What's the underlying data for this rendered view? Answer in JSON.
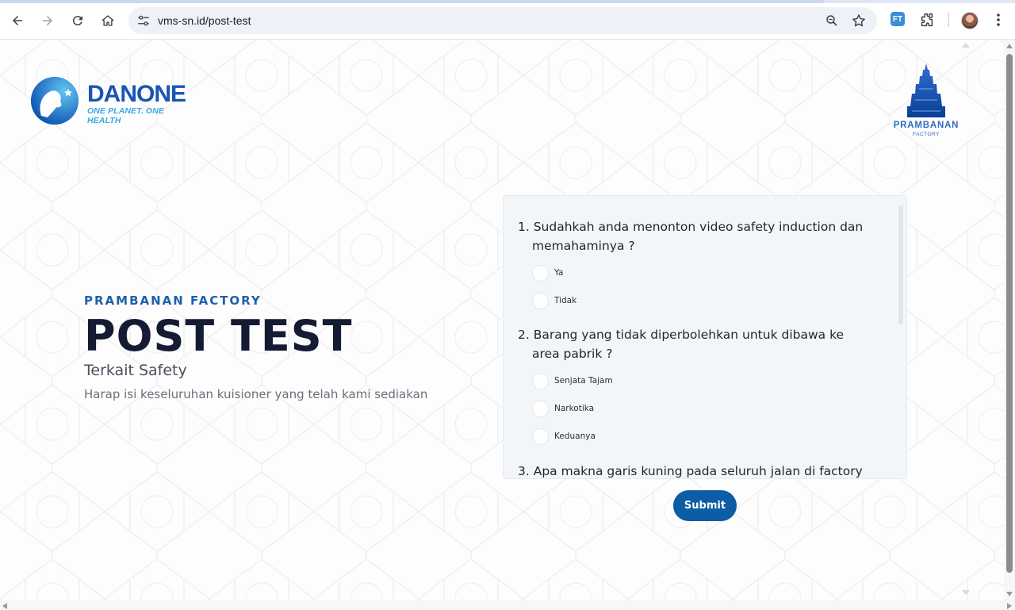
{
  "browser": {
    "url": "vms-sn.id/post-test",
    "extension_label": "FT",
    "icons": [
      "back-icon",
      "forward-icon",
      "reload-icon",
      "home-icon",
      "site-settings-icon",
      "zoom-icon",
      "bookmark-star-icon",
      "extensions-puzzle-icon",
      "profile-avatar",
      "more-menu-icon"
    ]
  },
  "logos": {
    "danone_wordmark": "DANONE",
    "danone_tagline": "ONE PLANET. ONE HEALTH",
    "prambanan_name": "PRAMBANAN",
    "prambanan_sub": "FACTORY"
  },
  "hero": {
    "eyebrow": "PRAMBANAN FACTORY",
    "title": "POST TEST",
    "subtitle": "Terkait Safety",
    "description": "Harap isi keseluruhan kuisioner yang telah kami sediakan"
  },
  "quiz": {
    "questions": [
      {
        "text": "1. Sudahkah anda menonton video safety induction dan memahaminya ?",
        "options": [
          "Ya",
          "Tidak"
        ]
      },
      {
        "text": "2. Barang yang tidak diperbolehkan untuk dibawa ke area pabrik ?",
        "options": [
          "Senjata Tajam",
          "Narkotika",
          "Keduanya"
        ]
      },
      {
        "text": "3. Apa makna garis kuning pada seluruh jalan di factory ?",
        "options": []
      }
    ],
    "submit_label": "Submit"
  },
  "colors": {
    "primary": "#0c5ca6",
    "eyebrow": "#1d61a8",
    "title": "#141b33",
    "panel_bg": "#f3f6f9"
  }
}
